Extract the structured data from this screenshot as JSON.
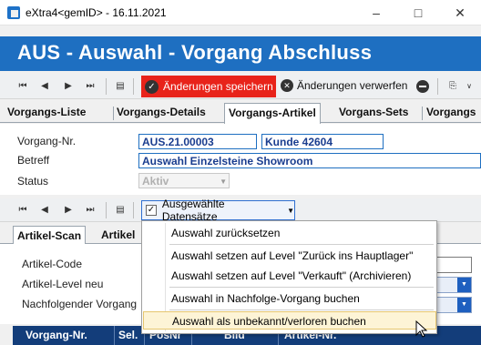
{
  "window": {
    "title": "eXtra4<gemID>  -  16.11.2021"
  },
  "header": {
    "title": "AUS - Auswahl - Vorgang Abschluss"
  },
  "toolbar": {
    "save_label": "Änderungen speichern",
    "discard_label": "Änderungen verwerfen",
    "save_color": "#e8231a"
  },
  "tabs": [
    "Vorgangs-Liste",
    "Vorgangs-Details",
    "Vorgangs-Artikel",
    "Vorgans-Sets",
    "Vorgangs"
  ],
  "form": {
    "vorgang_label": "Vorgang-Nr.",
    "vorgang_value": "AUS.21.00003",
    "kunde_value": "Kunde 42604",
    "betreff_label": "Betreff",
    "betreff_value": "Auswahl Einzelsteine Showroom",
    "status_label": "Status",
    "status_value": "Aktiv"
  },
  "selection_button": {
    "label": "Ausgewählte Datensätze"
  },
  "subtabs": [
    "Artikel-Scan",
    "Artikel"
  ],
  "lower_form": {
    "artikel_code_label": "Artikel-Code",
    "artikel_level_label": "Artikel-Level neu",
    "nachfolge_label": "Nachfolgender Vorgang"
  },
  "grid": {
    "columns": [
      "Vorgang-Nr.",
      "Sel.",
      "PosNr",
      "Bild",
      "Artikel-Nr."
    ]
  },
  "menu": {
    "items": [
      "Auswahl zurücksetzen",
      "Auswahl setzen auf Level \"Zurück ins Hauptlager\"",
      "Auswahl setzen auf Level \"Verkauft\" (Archivieren)",
      "Auswahl in Nachfolge-Vorgang buchen",
      "Auswahl als unbekannt/verloren buchen"
    ]
  },
  "colors": {
    "header": "#1e6fc1",
    "grid_header": "#133d7a",
    "highlight": "#fdf4d6"
  }
}
